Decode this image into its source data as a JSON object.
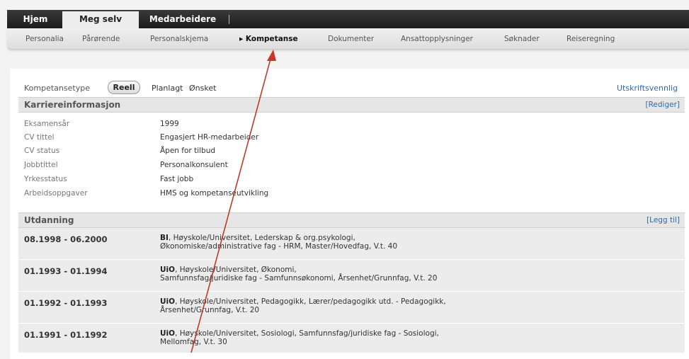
{
  "top_tabs": [
    {
      "label": "Hjem",
      "active": false
    },
    {
      "label": "Meg selv",
      "active": true
    },
    {
      "label": "Medarbeidere",
      "active": false
    }
  ],
  "sub_nav": [
    {
      "label": "Personalia",
      "active": false
    },
    {
      "label": "Pårørende",
      "active": false
    },
    {
      "label": "Personalskjema",
      "active": false
    },
    {
      "label": "▸ Kompetanse",
      "active": true
    },
    {
      "label": "Dokumenter",
      "active": false
    },
    {
      "label": "Ansattopplysninger",
      "active": false
    },
    {
      "label": "Søknader",
      "active": false
    },
    {
      "label": "Reiseregning",
      "active": false
    }
  ],
  "competence_type": {
    "label": "Kompetansetype",
    "options": [
      "Reell",
      "Planlagt",
      "Ønsket"
    ],
    "selected": "Reell"
  },
  "print_link": "Utskriftsvennlig",
  "career": {
    "title": "Karriereinformasjon",
    "action": "[Rediger]",
    "fields": [
      {
        "label": "Eksamensår",
        "value": "1999"
      },
      {
        "label": "CV tittel",
        "value": "Engasjert HR-medarbeider"
      },
      {
        "label": "CV status",
        "value": "Åpen for tilbud"
      },
      {
        "label": "Jobbtittel",
        "value": "Personalkonsulent"
      },
      {
        "label": "Yrkesstatus",
        "value": "Fast jobb"
      },
      {
        "label": "Arbeidsoppgaver",
        "value": "HMS og kompetanseutvikling"
      }
    ]
  },
  "education": {
    "title": "Utdanning",
    "action": "[Legg til]",
    "rows": [
      {
        "date": "08.1998 - 06.2000",
        "institution": "BI",
        "line1": ", Høyskole/Universitet, Lederskap & org.psykologi,",
        "line2": "Økonomiske/administrative fag - HRM, Master/Hovedfag, V.t. 40"
      },
      {
        "date": "01.1993 - 01.1994",
        "institution": "UiO",
        "line1": ", Høyskole/Universitet, Økonomi,",
        "line2": "Samfunnsfag/juridiske fag - Samfunnsøkonomi, Årsenhet/Grunnfag, V.t. 20"
      },
      {
        "date": "01.1992 - 01.1993",
        "institution": "UiO",
        "line1": ", Høyskole/Universitet, Pedagogikk, Lærer/pedagogikk utd. - Pedagogikk,",
        "line2": "Årsenhet/Grunnfag, V.t. 20"
      },
      {
        "date": "01.1991 - 01.1992",
        "institution": "UiO",
        "line1": ", Høyskole/Universitet, Sosiologi, Samfunnsfag/juridiske fag - Sosiologi,",
        "line2": "Mellomfag, V.t. 30"
      }
    ]
  },
  "annotation_color": "#c0392b"
}
